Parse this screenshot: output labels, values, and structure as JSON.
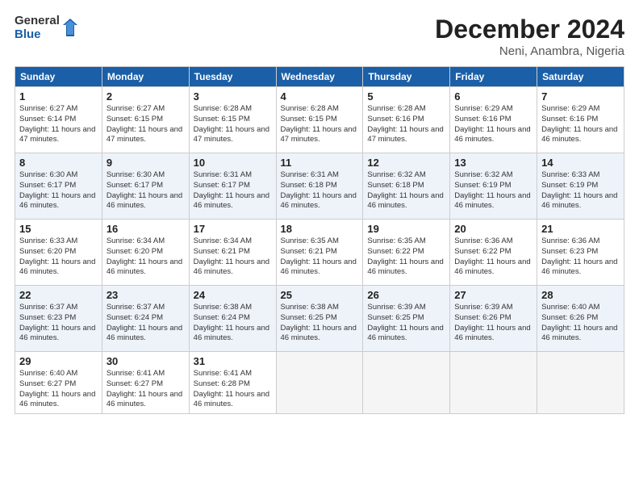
{
  "logo": {
    "general": "General",
    "blue": "Blue"
  },
  "title": {
    "month": "December 2024",
    "location": "Neni, Anambra, Nigeria"
  },
  "headers": [
    "Sunday",
    "Monday",
    "Tuesday",
    "Wednesday",
    "Thursday",
    "Friday",
    "Saturday"
  ],
  "weeks": [
    [
      {
        "day": "1",
        "sunrise": "Sunrise: 6:27 AM",
        "sunset": "Sunset: 6:14 PM",
        "daylight": "Daylight: 11 hours and 47 minutes."
      },
      {
        "day": "2",
        "sunrise": "Sunrise: 6:27 AM",
        "sunset": "Sunset: 6:15 PM",
        "daylight": "Daylight: 11 hours and 47 minutes."
      },
      {
        "day": "3",
        "sunrise": "Sunrise: 6:28 AM",
        "sunset": "Sunset: 6:15 PM",
        "daylight": "Daylight: 11 hours and 47 minutes."
      },
      {
        "day": "4",
        "sunrise": "Sunrise: 6:28 AM",
        "sunset": "Sunset: 6:15 PM",
        "daylight": "Daylight: 11 hours and 47 minutes."
      },
      {
        "day": "5",
        "sunrise": "Sunrise: 6:28 AM",
        "sunset": "Sunset: 6:16 PM",
        "daylight": "Daylight: 11 hours and 47 minutes."
      },
      {
        "day": "6",
        "sunrise": "Sunrise: 6:29 AM",
        "sunset": "Sunset: 6:16 PM",
        "daylight": "Daylight: 11 hours and 46 minutes."
      },
      {
        "day": "7",
        "sunrise": "Sunrise: 6:29 AM",
        "sunset": "Sunset: 6:16 PM",
        "daylight": "Daylight: 11 hours and 46 minutes."
      }
    ],
    [
      {
        "day": "8",
        "sunrise": "Sunrise: 6:30 AM",
        "sunset": "Sunset: 6:17 PM",
        "daylight": "Daylight: 11 hours and 46 minutes."
      },
      {
        "day": "9",
        "sunrise": "Sunrise: 6:30 AM",
        "sunset": "Sunset: 6:17 PM",
        "daylight": "Daylight: 11 hours and 46 minutes."
      },
      {
        "day": "10",
        "sunrise": "Sunrise: 6:31 AM",
        "sunset": "Sunset: 6:17 PM",
        "daylight": "Daylight: 11 hours and 46 minutes."
      },
      {
        "day": "11",
        "sunrise": "Sunrise: 6:31 AM",
        "sunset": "Sunset: 6:18 PM",
        "daylight": "Daylight: 11 hours and 46 minutes."
      },
      {
        "day": "12",
        "sunrise": "Sunrise: 6:32 AM",
        "sunset": "Sunset: 6:18 PM",
        "daylight": "Daylight: 11 hours and 46 minutes."
      },
      {
        "day": "13",
        "sunrise": "Sunrise: 6:32 AM",
        "sunset": "Sunset: 6:19 PM",
        "daylight": "Daylight: 11 hours and 46 minutes."
      },
      {
        "day": "14",
        "sunrise": "Sunrise: 6:33 AM",
        "sunset": "Sunset: 6:19 PM",
        "daylight": "Daylight: 11 hours and 46 minutes."
      }
    ],
    [
      {
        "day": "15",
        "sunrise": "Sunrise: 6:33 AM",
        "sunset": "Sunset: 6:20 PM",
        "daylight": "Daylight: 11 hours and 46 minutes."
      },
      {
        "day": "16",
        "sunrise": "Sunrise: 6:34 AM",
        "sunset": "Sunset: 6:20 PM",
        "daylight": "Daylight: 11 hours and 46 minutes."
      },
      {
        "day": "17",
        "sunrise": "Sunrise: 6:34 AM",
        "sunset": "Sunset: 6:21 PM",
        "daylight": "Daylight: 11 hours and 46 minutes."
      },
      {
        "day": "18",
        "sunrise": "Sunrise: 6:35 AM",
        "sunset": "Sunset: 6:21 PM",
        "daylight": "Daylight: 11 hours and 46 minutes."
      },
      {
        "day": "19",
        "sunrise": "Sunrise: 6:35 AM",
        "sunset": "Sunset: 6:22 PM",
        "daylight": "Daylight: 11 hours and 46 minutes."
      },
      {
        "day": "20",
        "sunrise": "Sunrise: 6:36 AM",
        "sunset": "Sunset: 6:22 PM",
        "daylight": "Daylight: 11 hours and 46 minutes."
      },
      {
        "day": "21",
        "sunrise": "Sunrise: 6:36 AM",
        "sunset": "Sunset: 6:23 PM",
        "daylight": "Daylight: 11 hours and 46 minutes."
      }
    ],
    [
      {
        "day": "22",
        "sunrise": "Sunrise: 6:37 AM",
        "sunset": "Sunset: 6:23 PM",
        "daylight": "Daylight: 11 hours and 46 minutes."
      },
      {
        "day": "23",
        "sunrise": "Sunrise: 6:37 AM",
        "sunset": "Sunset: 6:24 PM",
        "daylight": "Daylight: 11 hours and 46 minutes."
      },
      {
        "day": "24",
        "sunrise": "Sunrise: 6:38 AM",
        "sunset": "Sunset: 6:24 PM",
        "daylight": "Daylight: 11 hours and 46 minutes."
      },
      {
        "day": "25",
        "sunrise": "Sunrise: 6:38 AM",
        "sunset": "Sunset: 6:25 PM",
        "daylight": "Daylight: 11 hours and 46 minutes."
      },
      {
        "day": "26",
        "sunrise": "Sunrise: 6:39 AM",
        "sunset": "Sunset: 6:25 PM",
        "daylight": "Daylight: 11 hours and 46 minutes."
      },
      {
        "day": "27",
        "sunrise": "Sunrise: 6:39 AM",
        "sunset": "Sunset: 6:26 PM",
        "daylight": "Daylight: 11 hours and 46 minutes."
      },
      {
        "day": "28",
        "sunrise": "Sunrise: 6:40 AM",
        "sunset": "Sunset: 6:26 PM",
        "daylight": "Daylight: 11 hours and 46 minutes."
      }
    ],
    [
      {
        "day": "29",
        "sunrise": "Sunrise: 6:40 AM",
        "sunset": "Sunset: 6:27 PM",
        "daylight": "Daylight: 11 hours and 46 minutes."
      },
      {
        "day": "30",
        "sunrise": "Sunrise: 6:41 AM",
        "sunset": "Sunset: 6:27 PM",
        "daylight": "Daylight: 11 hours and 46 minutes."
      },
      {
        "day": "31",
        "sunrise": "Sunrise: 6:41 AM",
        "sunset": "Sunset: 6:28 PM",
        "daylight": "Daylight: 11 hours and 46 minutes."
      },
      null,
      null,
      null,
      null
    ]
  ]
}
